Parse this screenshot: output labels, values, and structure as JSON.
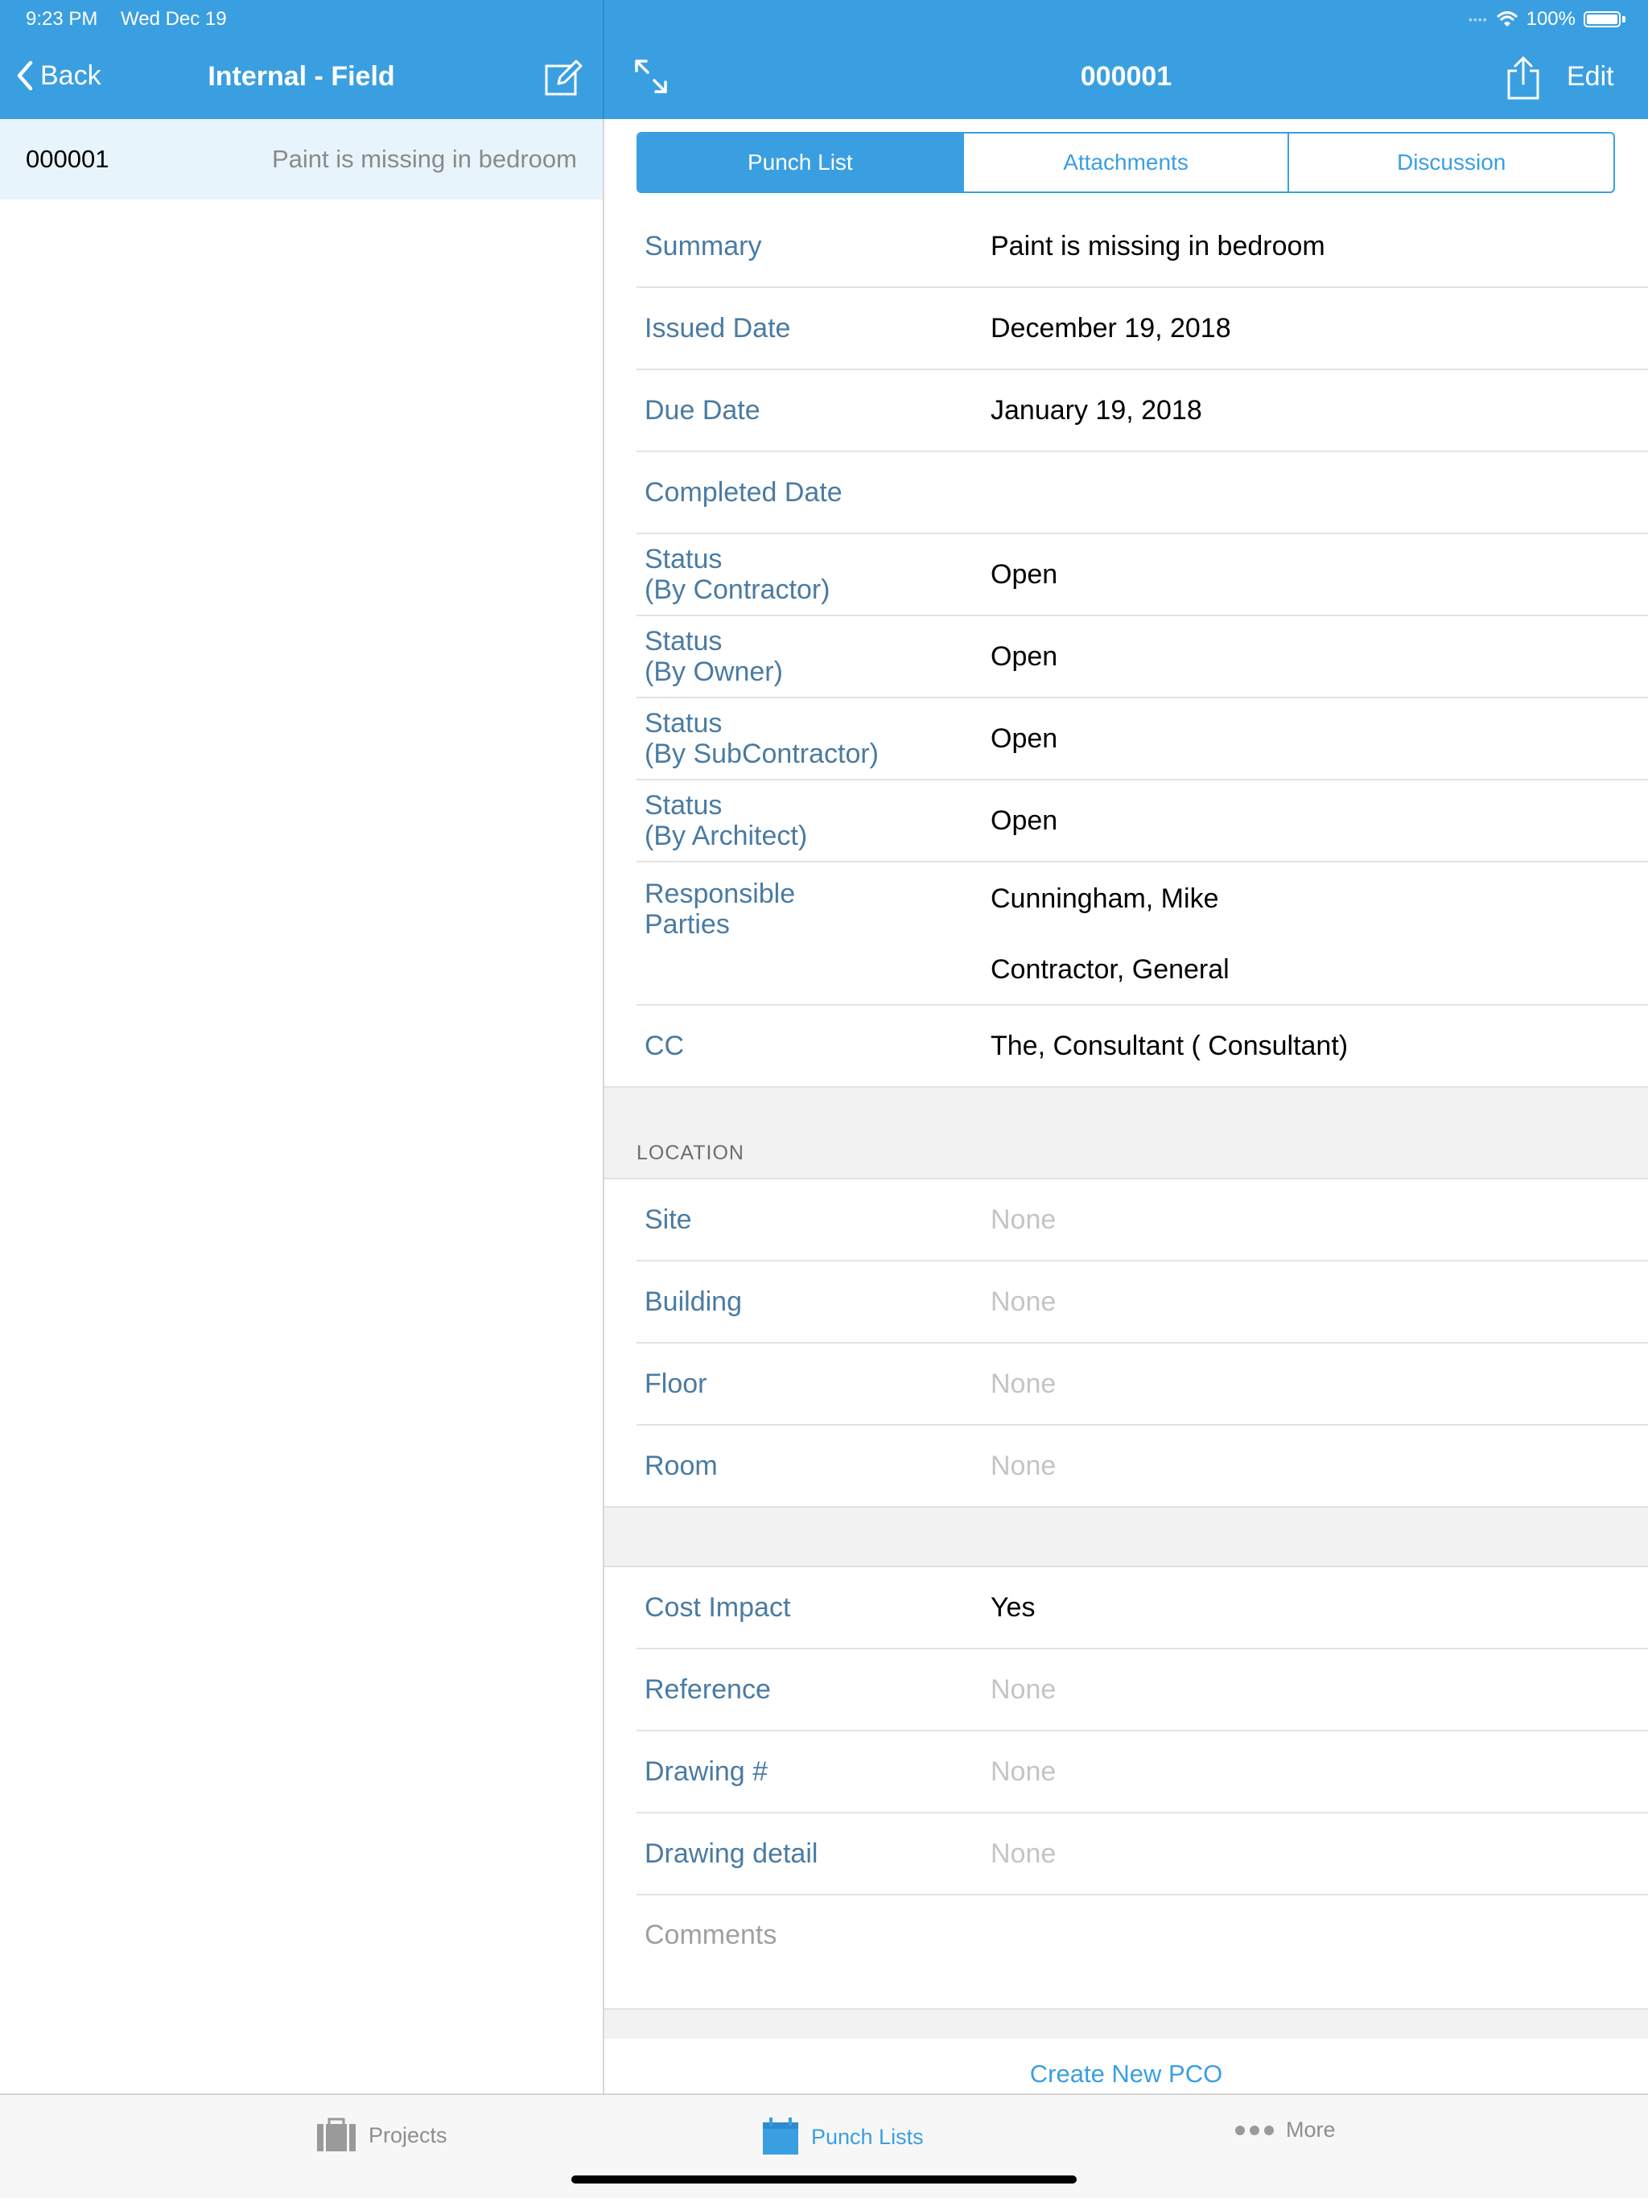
{
  "status_bar": {
    "time": "9:23 PM",
    "date": "Wed Dec 19",
    "battery": "100%"
  },
  "left_header": {
    "back_label": "Back",
    "title": "Internal - Field"
  },
  "right_header": {
    "title": "000001",
    "edit_label": "Edit"
  },
  "list": [
    {
      "id": "000001",
      "summary": "Paint is missing in bedroom"
    }
  ],
  "tabs": [
    "Punch List",
    "Attachments",
    "Discussion"
  ],
  "details": {
    "summary": {
      "label": "Summary",
      "value": "Paint is missing in bedroom"
    },
    "issued": {
      "label": "Issued Date",
      "value": "December 19, 2018"
    },
    "due": {
      "label": "Due Date",
      "value": "January 19, 2018"
    },
    "completed": {
      "label": "Completed Date",
      "value": ""
    },
    "status_contractor": {
      "label1": "Status",
      "label2": "(By Contractor)",
      "value": "Open"
    },
    "status_owner": {
      "label1": "Status",
      "label2": "(By Owner)",
      "value": "Open"
    },
    "status_sub": {
      "label1": "Status",
      "label2": "(By SubContractor)",
      "value": "Open"
    },
    "status_architect": {
      "label1": "Status",
      "label2": "(By Architect)",
      "value": "Open"
    },
    "responsible": {
      "label1": "Responsible",
      "label2": "Parties",
      "values": [
        "Cunningham, Mike",
        "Contractor, General"
      ]
    },
    "cc": {
      "label": "CC",
      "value": "The, Consultant ( Consultant)"
    }
  },
  "location": {
    "header": "LOCATION",
    "site": {
      "label": "Site",
      "value": "None"
    },
    "building": {
      "label": "Building",
      "value": "None"
    },
    "floor": {
      "label": "Floor",
      "value": "None"
    },
    "room": {
      "label": "Room",
      "value": "None"
    }
  },
  "extra": {
    "cost_impact": {
      "label": "Cost Impact",
      "value": "Yes"
    },
    "reference": {
      "label": "Reference",
      "value": "None"
    },
    "drawing_num": {
      "label": "Drawing #",
      "value": "None"
    },
    "drawing_detail": {
      "label": "Drawing detail",
      "value": "None"
    },
    "comments": {
      "label": "Comments"
    }
  },
  "create_pco": "Create New PCO",
  "tab_bar": {
    "projects": "Projects",
    "punch_lists": "Punch Lists",
    "more": "More"
  },
  "colors": {
    "accent": "#3a9fe1",
    "label": "#4a7ba3",
    "placeholder": "#c4c4c4"
  }
}
